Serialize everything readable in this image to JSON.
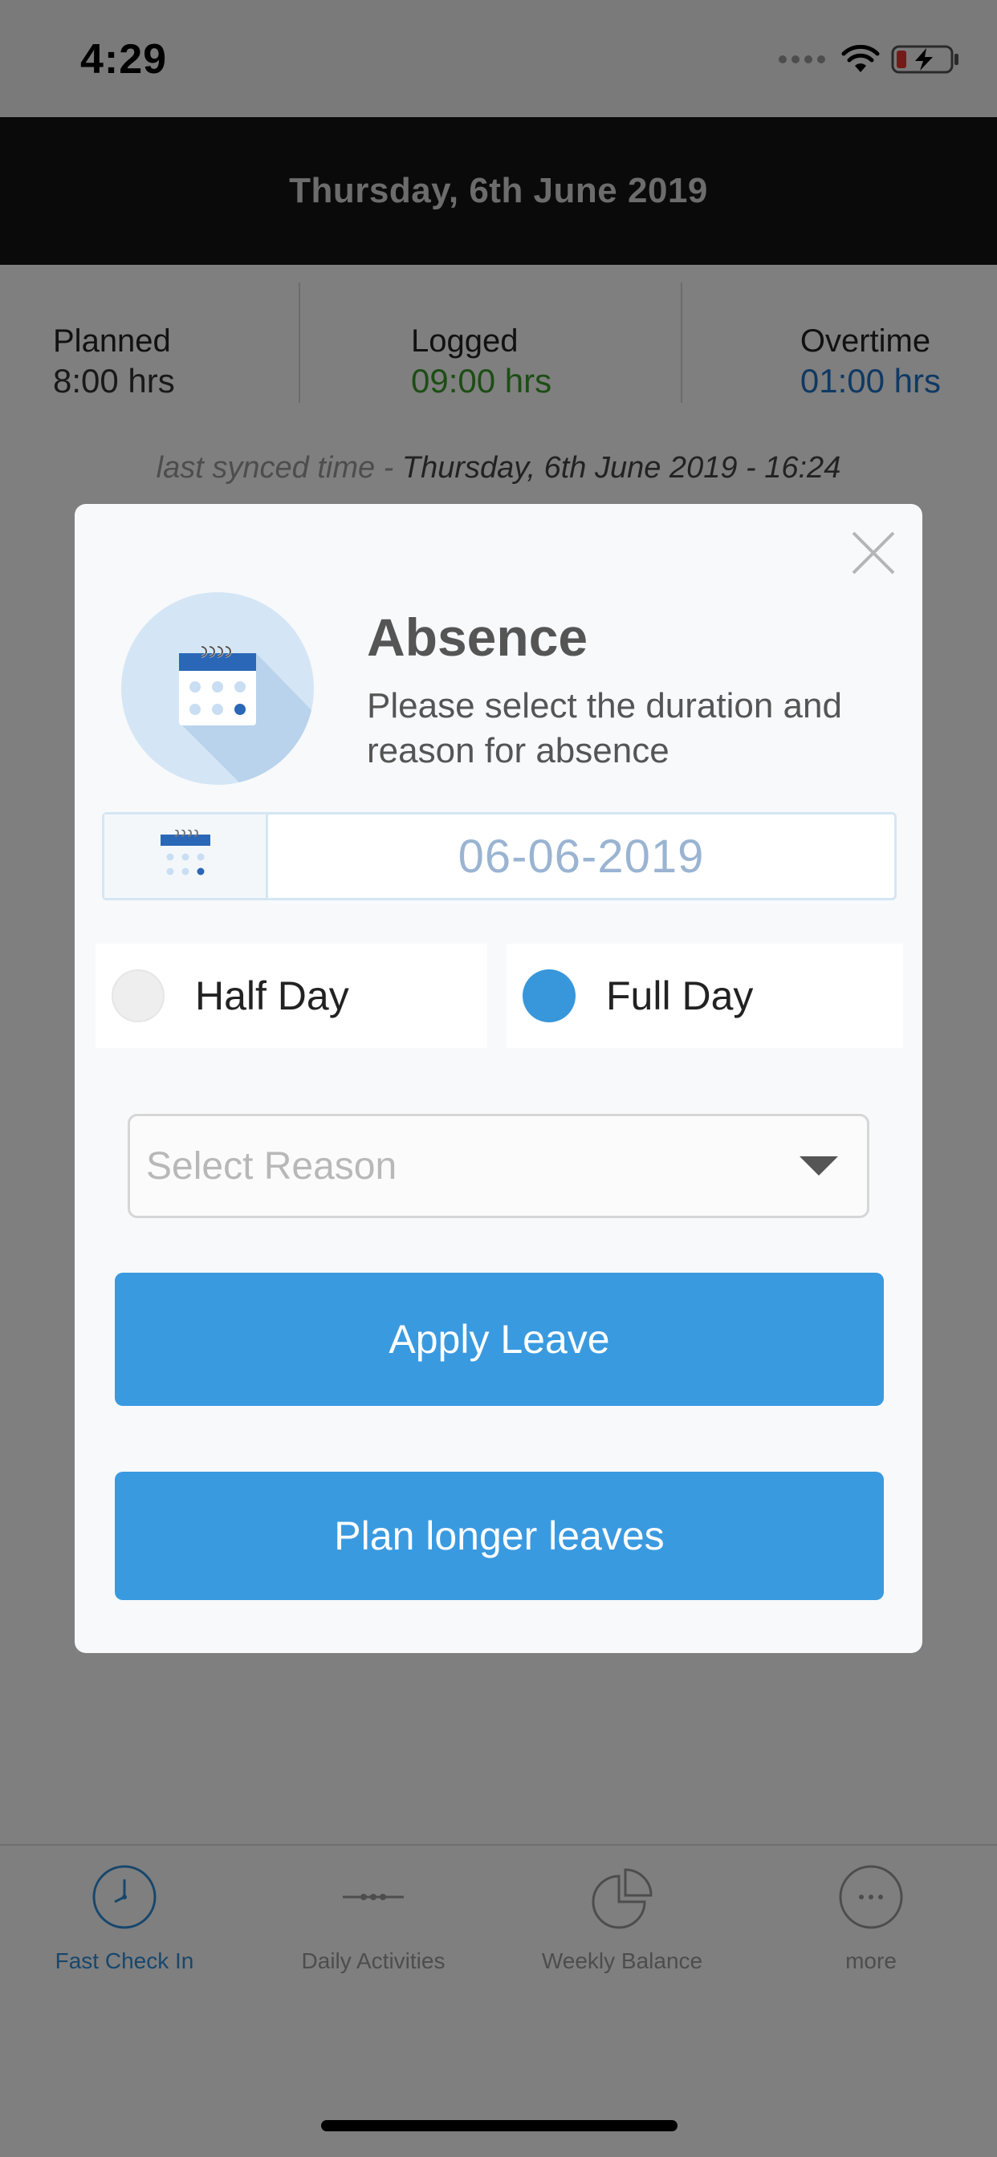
{
  "status_bar": {
    "time": "4:29"
  },
  "header": {
    "date_title": "Thursday, 6th June 2019"
  },
  "summary": {
    "planned": {
      "label": "Planned",
      "value": "8:00 hrs"
    },
    "logged": {
      "label": "Logged",
      "value": "09:00 hrs"
    },
    "overtime": {
      "label": "Overtime",
      "value": "01:00 hrs"
    },
    "sync_label": "last synced time - ",
    "sync_value": "Thursday, 6th June 2019 - 16:24"
  },
  "modal": {
    "title": "Absence",
    "subtitle": "Please select the duration and reason for absence",
    "date_value": "06-06-2019",
    "options": {
      "half_day": {
        "label": "Half Day",
        "selected": false
      },
      "full_day": {
        "label": "Full Day",
        "selected": true
      }
    },
    "reason_placeholder": "Select Reason",
    "apply_button": "Apply Leave",
    "plan_button": "Plan longer leaves"
  },
  "bottom_nav": {
    "items": [
      {
        "label": "Fast Check In",
        "icon": "clock-icon",
        "active": true
      },
      {
        "label": "Daily Activities",
        "icon": "activities-icon",
        "active": false
      },
      {
        "label": "Weekly Balance",
        "icon": "pie-chart-icon",
        "active": false
      },
      {
        "label": "more",
        "icon": "more-icon",
        "active": false
      }
    ]
  },
  "colors": {
    "accent": "#3a9ae0",
    "logged_green": "#3a9a2a",
    "overtime_blue": "#1f73c7",
    "header_bg": "#141414"
  }
}
